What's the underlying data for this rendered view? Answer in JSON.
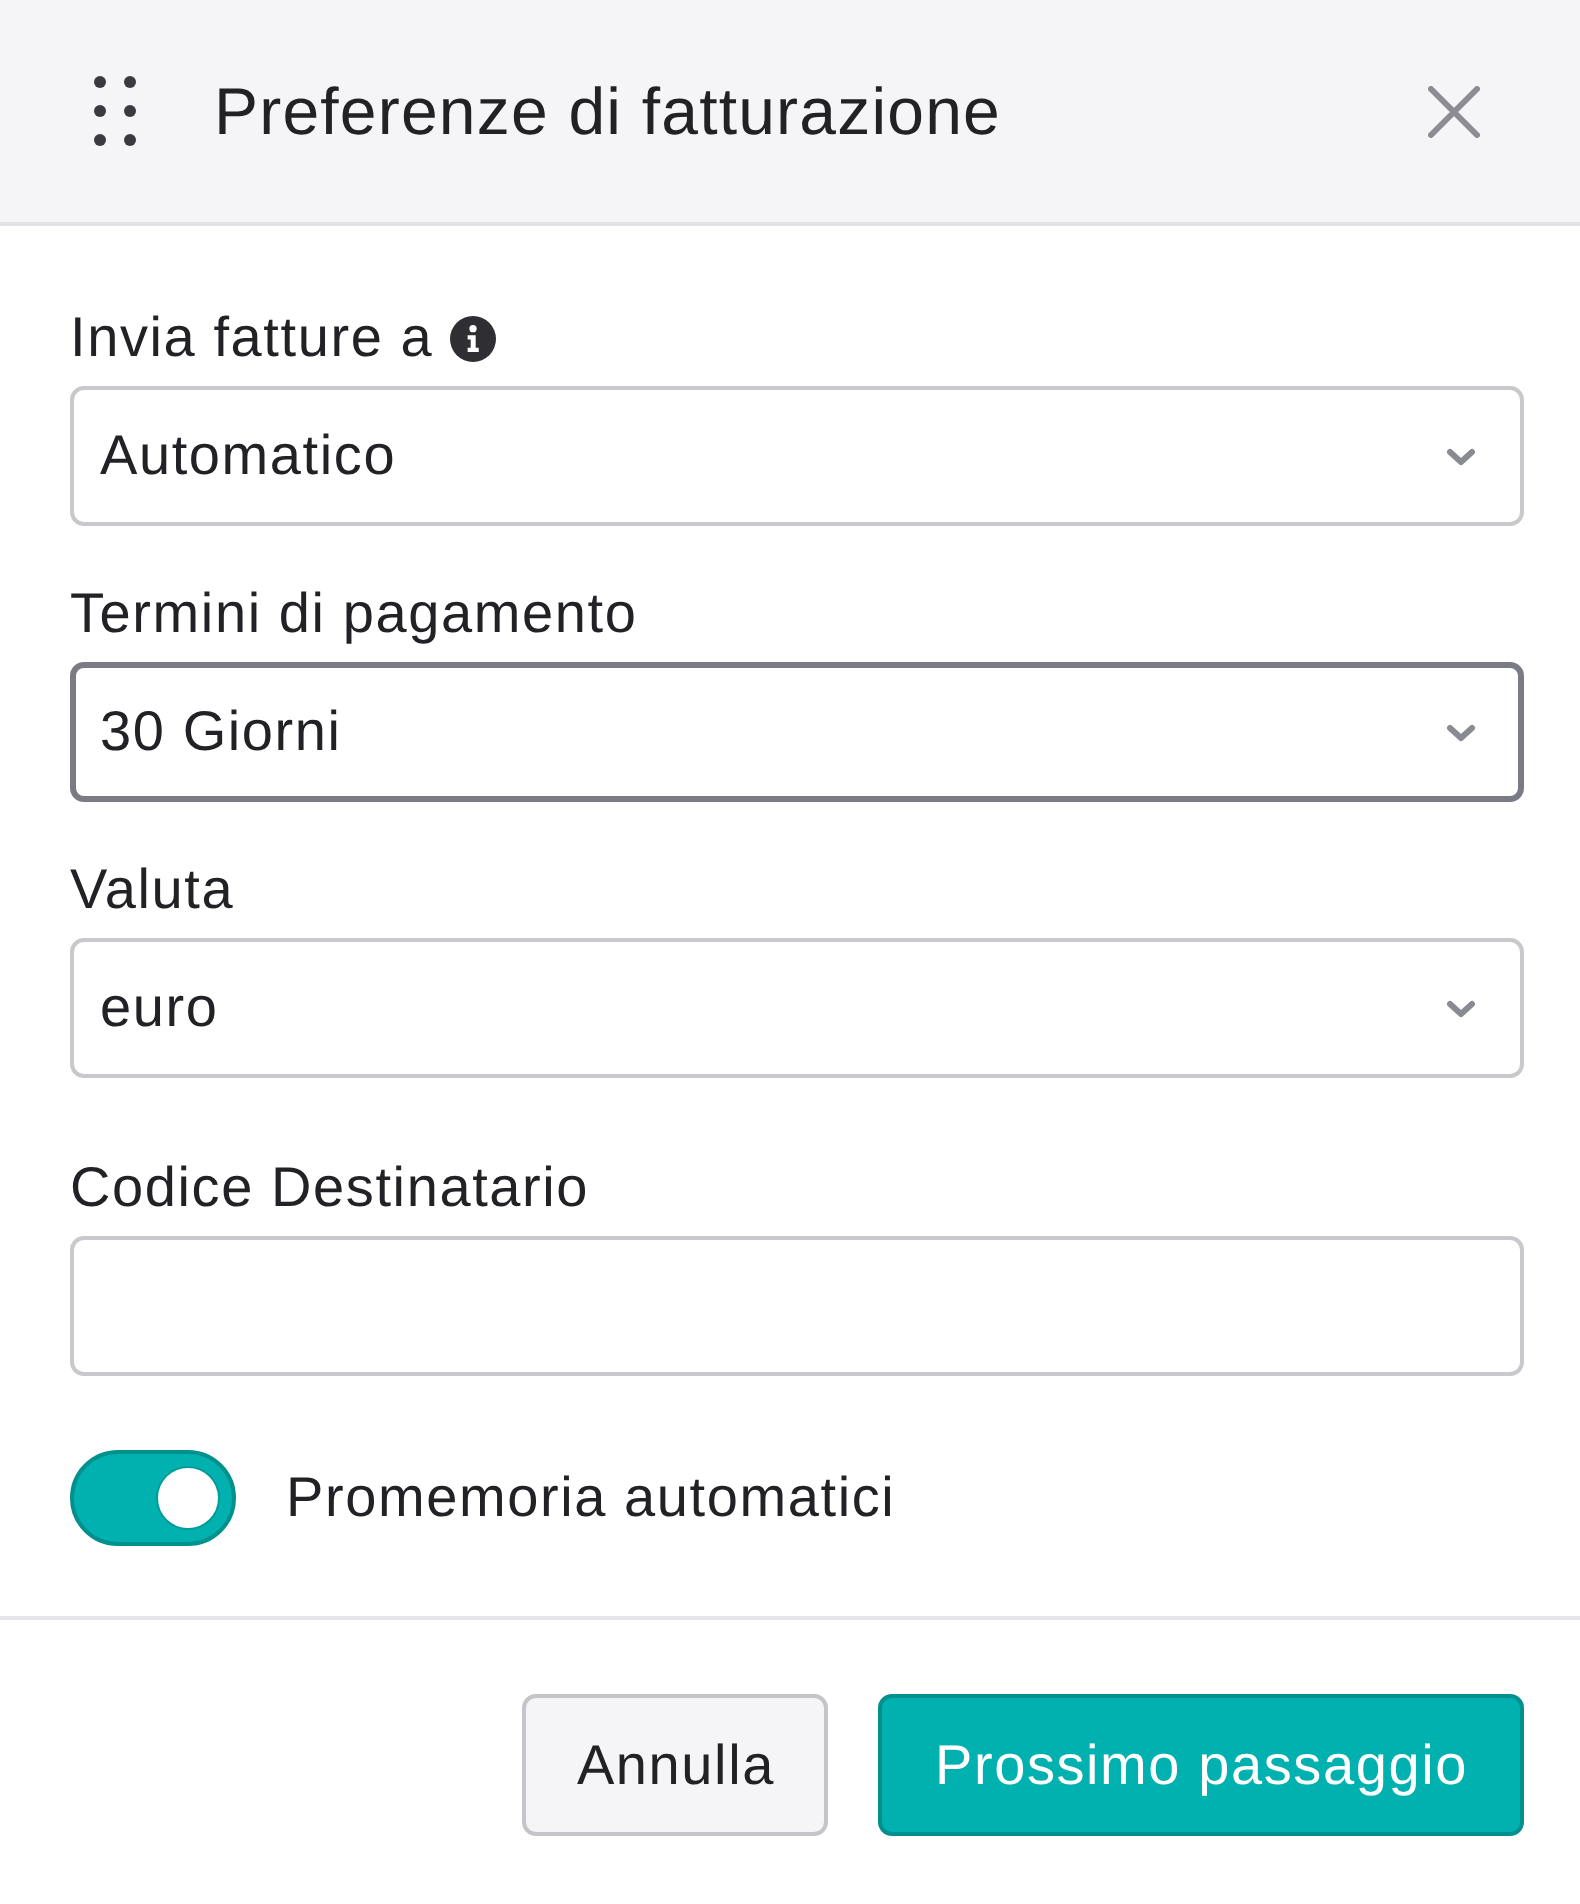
{
  "dialog": {
    "title": "Preferenze di fatturazione"
  },
  "fields": [
    {
      "kind": "select",
      "label": "Invia fatture a",
      "info": true,
      "value": "Automatico",
      "focused": false
    },
    {
      "kind": "select",
      "label": "Termini di pagamento",
      "info": false,
      "value": "30 Giorni",
      "focused": true
    },
    {
      "kind": "select",
      "label": "Valuta",
      "info": false,
      "value": "euro",
      "focused": false
    },
    {
      "kind": "text",
      "label": "Codice Destinatario",
      "info": false,
      "focused": false
    }
  ],
  "toggle": {
    "label": "Promemoria automatici",
    "on": true
  },
  "buttons": [
    {
      "kind": "secondary",
      "label": "Annulla"
    },
    {
      "kind": "primary",
      "label": "Prossimo passaggio"
    }
  ]
}
